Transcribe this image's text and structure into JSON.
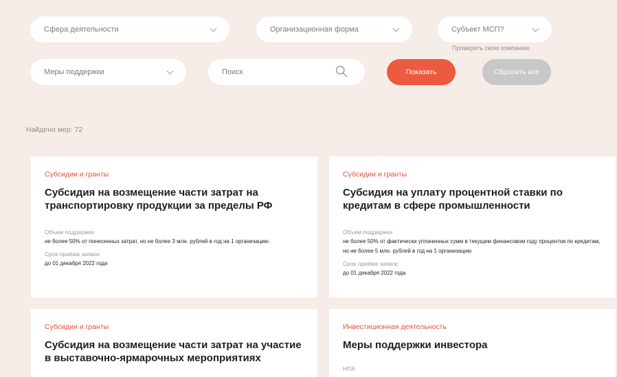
{
  "filters": {
    "sphere": {
      "label": "Сфера деятельности"
    },
    "org_form": {
      "label": "Организационная форма"
    },
    "msp": {
      "label": "Субъект МСП?",
      "hint": "Проверить свою компанию"
    },
    "measures": {
      "label": "Меры поддержки"
    },
    "search": {
      "placeholder": "Поиск"
    },
    "show_label": "Показать",
    "reset_label": "Сбросить все"
  },
  "results": {
    "found_text": "Найдено мер: 72"
  },
  "cards": [
    {
      "category": "Субсидии и гранты",
      "title": "Субсидия на возмещение части затрат на транспортировку продукции за пределы РФ",
      "volume_label": "Объем поддержки",
      "volume_value": "не более 50% от понесенных затрат, но не более 3 млн. рублей в год на 1 организацию",
      "deadline_label": "Срок приёма заявок:",
      "deadline_value": "до 01 декабря 2022 года"
    },
    {
      "category": "Субсидии и гранты",
      "title": "Субсидия на уплату процентной ставки по кредитам в сфере промышленности",
      "volume_label": "Объем поддержки",
      "volume_value": "не более 50% от фактически уплаченных сумм в текущем финансовом году процентов по кредитам, но не более 5 млн. рублей в год на 1 организацию",
      "deadline_label": "Срок приёма заявок:",
      "deadline_value": "до 01 декабря 2022 года"
    },
    {
      "category": "Субсидии и гранты",
      "title": "Субсидия на возмещение части затрат на участие в выставочно-ярмарочных мероприятиях"
    },
    {
      "category": "Инвестиционная деятельность",
      "title": "Меры поддержки инвестора",
      "volume_label": "НПА"
    }
  ]
}
